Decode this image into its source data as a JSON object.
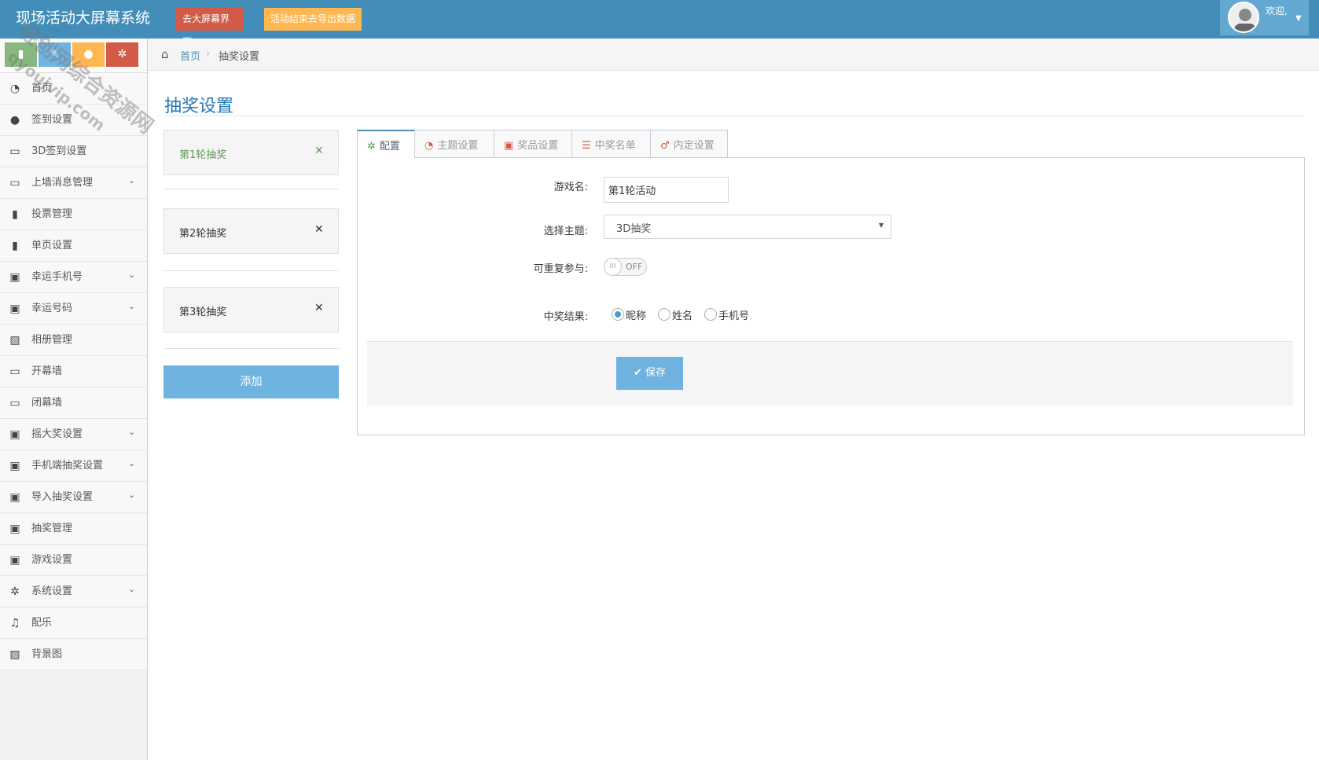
{
  "header": {
    "app_title": "现场活动大屏幕系统",
    "btn_bigscreen": "去大屏幕界面",
    "btn_export": "活动结束去导出数据",
    "welcome": "欢迎,"
  },
  "colors": {
    "header_bg": "#438eb9",
    "accent_blue": "#6fb3e0",
    "danger": "#d15b47",
    "warning": "#ffb752",
    "success": "#87b87f"
  },
  "sidebar": {
    "shortcuts": [
      {
        "icon": "signal-icon",
        "color": "#87b87f"
      },
      {
        "icon": "pencil-icon",
        "color": "#6fb3e0"
      },
      {
        "icon": "group-icon",
        "color": "#ffb752"
      },
      {
        "icon": "cogs-icon",
        "color": "#d15b47"
      }
    ],
    "items": [
      {
        "label": "首页",
        "icon": "dashboard-icon",
        "submenu": false
      },
      {
        "label": "签到设置",
        "icon": "group-icon",
        "submenu": false
      },
      {
        "label": "3D签到设置",
        "icon": "desktop-icon",
        "submenu": false
      },
      {
        "label": "上墙消息管理",
        "icon": "desktop-icon",
        "submenu": true
      },
      {
        "label": "投票管理",
        "icon": "signal-icon",
        "submenu": false
      },
      {
        "label": "单页设置",
        "icon": "signal-icon",
        "submenu": false
      },
      {
        "label": "幸运手机号",
        "icon": "gift-icon",
        "submenu": true
      },
      {
        "label": "幸运号码",
        "icon": "gift-icon",
        "submenu": true
      },
      {
        "label": "相册管理",
        "icon": "picture-icon",
        "submenu": false
      },
      {
        "label": "开幕墙",
        "icon": "desktop-icon",
        "submenu": false
      },
      {
        "label": "闭幕墙",
        "icon": "desktop-icon",
        "submenu": false
      },
      {
        "label": "摇大奖设置",
        "icon": "gift-icon",
        "submenu": true
      },
      {
        "label": "手机端抽奖设置",
        "icon": "gift-icon",
        "submenu": true
      },
      {
        "label": "导入抽奖设置",
        "icon": "gift-icon",
        "submenu": true
      },
      {
        "label": "抽奖管理",
        "icon": "gift-icon",
        "submenu": false
      },
      {
        "label": "游戏设置",
        "icon": "gift-icon",
        "submenu": false
      },
      {
        "label": "系统设置",
        "icon": "cog-icon",
        "submenu": true
      },
      {
        "label": "配乐",
        "icon": "music-icon",
        "submenu": false
      },
      {
        "label": "背景图",
        "icon": "picture-icon",
        "submenu": false
      }
    ]
  },
  "breadcrumb": {
    "home": "首页",
    "current": "抽奖设置"
  },
  "page_title": "抽奖设置",
  "rounds": [
    {
      "label": "第1轮抽奖",
      "active": true
    },
    {
      "label": "第2轮抽奖",
      "active": false
    },
    {
      "label": "第3轮抽奖",
      "active": false
    }
  ],
  "add_button": "添加",
  "tabs": [
    {
      "label": "配置",
      "icon": "cog-icon",
      "active": true
    },
    {
      "label": "主题设置",
      "icon": "dashboard-icon",
      "active": false
    },
    {
      "label": "奖品设置",
      "icon": "gift-icon",
      "active": false
    },
    {
      "label": "中奖名单",
      "icon": "list-icon",
      "active": false
    },
    {
      "label": "内定设置",
      "icon": "male-icon",
      "active": false
    }
  ],
  "form": {
    "game_name_label": "游戏名:",
    "game_name_value": "第1轮活动",
    "theme_label": "选择主题:",
    "theme_value": "3D抽奖",
    "repeat_label": "可重复参与:",
    "repeat_toggle": "OFF",
    "result_label": "中奖结果:",
    "result_options": [
      "昵称",
      "姓名",
      "手机号"
    ],
    "result_selected": "昵称",
    "save_button": "保存"
  },
  "watermark": {
    "line1": "轻创网综合资源网",
    "line2": "qyoujvip.com"
  }
}
